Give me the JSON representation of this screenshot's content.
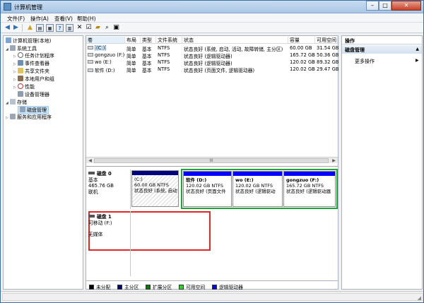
{
  "window": {
    "title": "计算机管理",
    "controls": {
      "minimize": "–",
      "maximize": "□",
      "close": "✕"
    }
  },
  "menu": [
    "文件(F)",
    "操作(A)",
    "查看(V)",
    "帮助(H)"
  ],
  "tree": {
    "root": "计算机管理(本地)",
    "system_tools": "系统工具",
    "task_scheduler": "任务计划程序",
    "event_viewer": "事件查看器",
    "shared_folders": "共享文件夹",
    "local_users": "本地用户和组",
    "performance": "性能",
    "device_manager": "设备管理器",
    "storage": "存储",
    "disk_management": "磁盘管理",
    "services": "服务和应用程序"
  },
  "volumes": {
    "headers": [
      "卷",
      "布局",
      "类型",
      "文件系统",
      "状态",
      "容量",
      "可用空间"
    ],
    "rows": [
      {
        "vol": "(C:)",
        "layout": "简单",
        "type": "基本",
        "fs": "NTFS",
        "status": "状态良好 (系统, 启动, 活动, 故障转储, 主分区)",
        "cap": "60.00 GB",
        "free": "31.54 GB"
      },
      {
        "vol": "gongzuo (F:)",
        "layout": "简单",
        "type": "基本",
        "fs": "NTFS",
        "status": "状态良好 (逻辑驱动器)",
        "cap": "165.72 GB",
        "free": "50.36 GB"
      },
      {
        "vol": "wo (E:)",
        "layout": "简单",
        "type": "基本",
        "fs": "NTFS",
        "status": "状态良好 (逻辑驱动器)",
        "cap": "120.02 GB",
        "free": "89.32 GB"
      },
      {
        "vol": "软件 (D:)",
        "layout": "简单",
        "type": "基本",
        "fs": "NTFS",
        "status": "状态良好 (页面文件, 逻辑驱动器)",
        "cap": "120.02 GB",
        "free": "29.47 GB"
      }
    ]
  },
  "scroll": {
    "thumb": "III",
    "left": "◀",
    "right": "▶"
  },
  "disk0": {
    "name": "磁盘 0",
    "type": "基本",
    "size": "465.76 GB",
    "status": "联机",
    "partitions": [
      {
        "name": "(C:)",
        "size": "60.00 GB NTFS",
        "status": "状态良好 (系统, 启动"
      },
      {
        "name": "软件 (D:)",
        "size": "120.02 GB NTFS",
        "status": "状态良好 (页面文件"
      },
      {
        "name": "wo (E:)",
        "size": "120.02 GB NTFS",
        "status": "状态良好 (逻辑驱动"
      },
      {
        "name": "gongzuo (F:)",
        "size": "165.72 GB NTFS",
        "status": "状态良好 (逻辑驱动器"
      }
    ]
  },
  "disk1": {
    "name": "磁盘 1",
    "desc": "可移动 (F:)",
    "media": "无媒体"
  },
  "legend": [
    {
      "label": "未分配",
      "color": "#000000"
    },
    {
      "label": "主分区",
      "color": "#000080"
    },
    {
      "label": "扩展分区",
      "color": "#008000"
    },
    {
      "label": "可用空间",
      "color": "#33cc33"
    },
    {
      "label": "逻辑驱动器",
      "color": "#0000ff"
    }
  ],
  "actions": {
    "header": "操作",
    "section": "磁盘管理",
    "more": "更多操作"
  },
  "colors": {
    "primary_partition": "#000080",
    "logical_drive": "#0000ff",
    "extended_highlight": "#1ea43a",
    "disk1_highlight": "#e32626"
  }
}
